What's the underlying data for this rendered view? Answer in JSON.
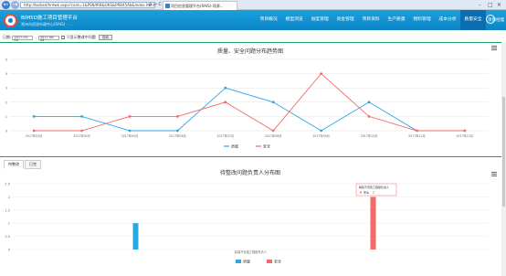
{
  "browser": {
    "address": "http://bs/bsd/hrdwk.aspx?cont=1&PSN/IRB&OKS&PRB45Ab&Index.html",
    "address_controls": "ρ → C",
    "tab_title": "项目信息管理平台(RAIS)-项源...",
    "back_icon": "←",
    "forward_icon": "→",
    "window_controls": [
      "–",
      "□",
      "✕"
    ]
  },
  "header": {
    "title": "BIM5D施工项目管理平台",
    "subtitle": "常州市武进市政中心(RAIS) - ...",
    "menu": [
      "项目概况",
      "模型浏览",
      "进度管理",
      "资金管理",
      "项目资料",
      "生产质量",
      "物料管理",
      "成本分析",
      "质量安全"
    ],
    "active_menu_index": 8,
    "user": "项目经理"
  },
  "filter": {
    "label": "日期:",
    "start": "2017-03-04",
    "dash": "-",
    "end": "2017-06-44",
    "checkbox_label": "只显示整改中问题",
    "query_button": "查询"
  },
  "colors": {
    "header": "#0c85c5",
    "accent_line": "#1b9e6e",
    "quality": "#29a8e0",
    "safety": "#f26a6a"
  },
  "chart_data": [
    {
      "type": "line",
      "title": "质量、安全问题分布趋势图",
      "categories": [
        "2017年03月",
        "2017年04月",
        "2017年05月",
        "2017年06月",
        "2017年07月",
        "2017年08月",
        "2017年09月",
        "2017年10月",
        "2017年11月",
        "2017年12月"
      ],
      "series": [
        {
          "name": "质量",
          "values": [
            1,
            1,
            0,
            0,
            3,
            2,
            0,
            2,
            0,
            0
          ]
        },
        {
          "name": "安全",
          "values": [
            0,
            0,
            1,
            1,
            2,
            0,
            4,
            1,
            0,
            0
          ]
        }
      ],
      "ylim": [
        0,
        5
      ],
      "yticks": [
        "0",
        "1",
        "2",
        "3",
        "4",
        "5"
      ],
      "grid": true,
      "legend": "bottom"
    },
    {
      "type": "bar",
      "title": "待整改问题负责人分布图",
      "categories": [
        "精装不安装工程部负责人"
      ],
      "series": [
        {
          "name": "质量",
          "values": [
            1
          ]
        },
        {
          "name": "安全",
          "values": [
            2
          ]
        }
      ],
      "ylim": [
        0,
        2.5
      ],
      "yticks": [
        "0",
        "0.5",
        "1",
        "1.5",
        "2",
        "2.5"
      ],
      "legend": "bottom",
      "tooltip": {
        "title": "精装不安装工程部负责人",
        "series": "安全",
        "value": "2"
      }
    }
  ],
  "panel2": {
    "tabs": [
      "待整改",
      "已完"
    ]
  }
}
